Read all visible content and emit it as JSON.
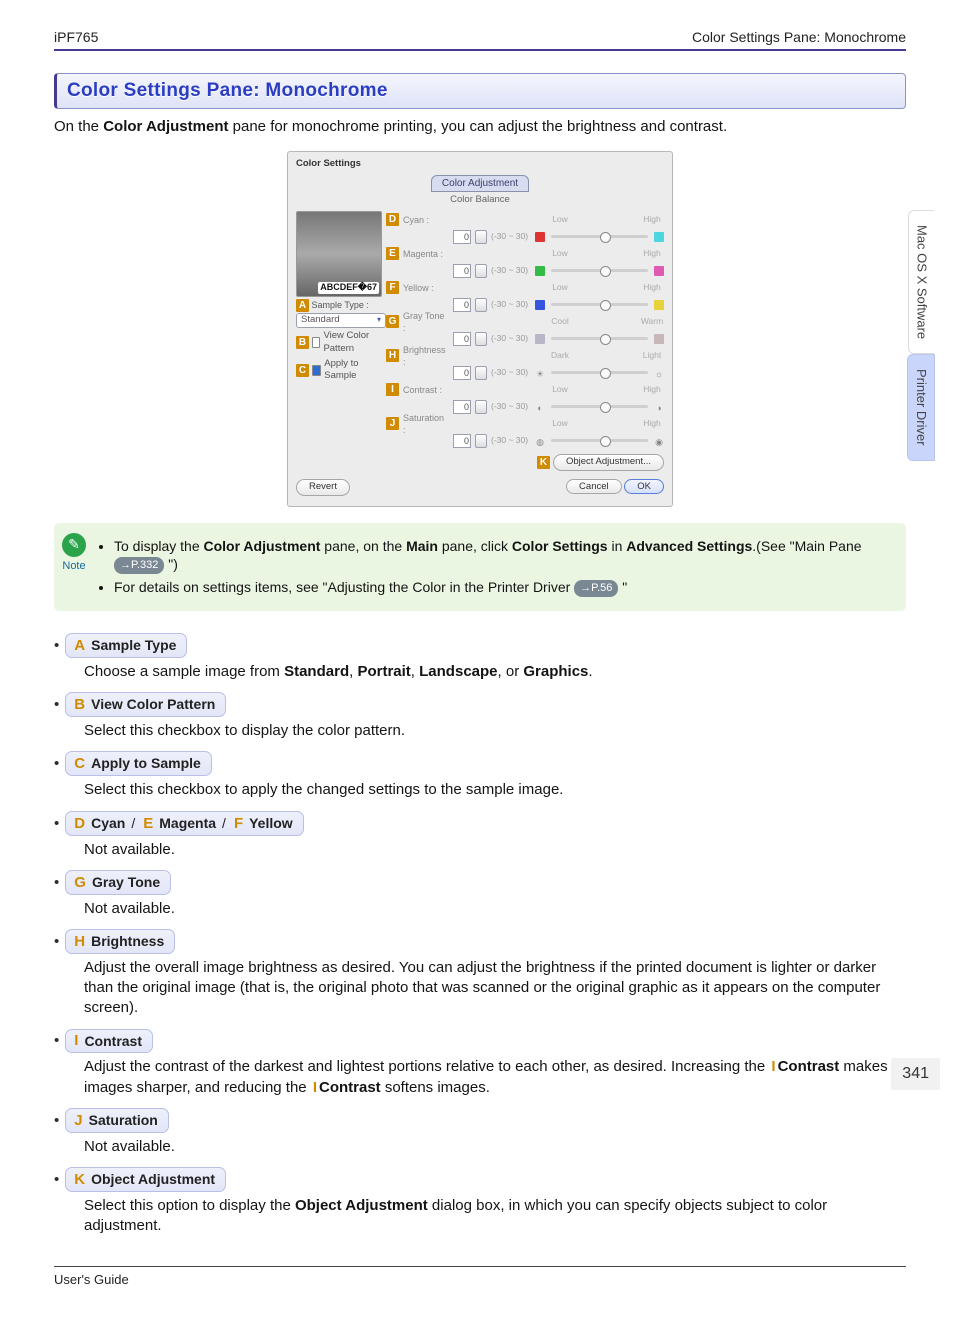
{
  "header": {
    "left": "iPF765",
    "right": "Color Settings Pane: Monochrome"
  },
  "title": "Color Settings Pane: Monochrome",
  "intro": {
    "pre": "On the ",
    "bold": "Color Adjustment",
    "post": " pane for monochrome printing, you can adjust the brightness and contrast."
  },
  "screenshot": {
    "window_title": "Color Settings",
    "tab_label": "Color Adjustment",
    "group_label": "Color Balance",
    "sample": {
      "marker": "A",
      "label": "Sample Type :",
      "dropdown_value": "Standard",
      "view_marker": "B",
      "view_label": "View Color Pattern",
      "apply_marker": "C",
      "apply_label": "Apply to Sample"
    },
    "sliders": [
      {
        "marker": "D",
        "label": "Cyan :",
        "value": "0",
        "range": "(-30 ~ 30)",
        "loLab": "Low",
        "hiLab": "High",
        "loColor": "#d33",
        "hiColor": "#4dd6e0"
      },
      {
        "marker": "E",
        "label": "Magenta :",
        "value": "0",
        "range": "(-30 ~ 30)",
        "loLab": "Low",
        "hiLab": "High",
        "loColor": "#3b4",
        "hiColor": "#e05ab4"
      },
      {
        "marker": "F",
        "label": "Yellow :",
        "value": "0",
        "range": "(-30 ~ 30)",
        "loLab": "Low",
        "hiLab": "High",
        "loColor": "#35d",
        "hiColor": "#e7d23a"
      },
      {
        "marker": "G",
        "label": "Gray Tone :",
        "value": "0",
        "range": "(-30 ~ 30)",
        "loLab": "Cool",
        "hiLab": "Warm",
        "loColor": "#b7b7c8",
        "hiColor": "#c8b7b7"
      },
      {
        "marker": "H",
        "label": "Brightness :",
        "value": "0",
        "range": "(-30 ~ 30)",
        "loLab": "Dark",
        "hiLab": "Light",
        "loGlyph": "☀",
        "hiGlyph": "☼"
      },
      {
        "marker": "I",
        "label": "Contrast :",
        "value": "0",
        "range": "(-30 ~ 30)",
        "loLab": "Low",
        "hiLab": "High",
        "loGlyph": "◐",
        "hiGlyph": "◑"
      },
      {
        "marker": "J",
        "label": "Saturation :",
        "value": "0",
        "range": "(-30 ~ 30)",
        "loLab": "Low",
        "hiLab": "High",
        "loGlyph": "◍",
        "hiGlyph": "◉"
      }
    ],
    "object_marker": "K",
    "object_btn": "Object Adjustment...",
    "revert_btn": "Revert",
    "cancel_btn": "Cancel",
    "ok_btn": "OK"
  },
  "note": {
    "caption": "Note",
    "items": [
      {
        "parts": [
          {
            "t": "text",
            "v": "To display the "
          },
          {
            "t": "b",
            "v": "Color Adjustment"
          },
          {
            "t": "text",
            "v": " pane, on the "
          },
          {
            "t": "b",
            "v": "Main"
          },
          {
            "t": "text",
            "v": " pane, click "
          },
          {
            "t": "b",
            "v": "Color Settings"
          },
          {
            "t": "text",
            "v": " in "
          },
          {
            "t": "b",
            "v": "Advanced Settings"
          },
          {
            "t": "text",
            "v": ".(See \"Main Pane "
          },
          {
            "t": "ref",
            "v": "→P.332"
          },
          {
            "t": "text",
            "v": " \")"
          }
        ]
      },
      {
        "parts": [
          {
            "t": "text",
            "v": "For details on settings items, see \"Adjusting the Color in the Printer Driver "
          },
          {
            "t": "ref",
            "v": "→P.56"
          },
          {
            "t": "text",
            "v": " \""
          }
        ]
      }
    ]
  },
  "items": [
    {
      "head": [
        {
          "mk": "A",
          "text": "Sample Type"
        }
      ],
      "desc": [
        {
          "t": "text",
          "v": "Choose a sample image from "
        },
        {
          "t": "b",
          "v": "Standard"
        },
        {
          "t": "text",
          "v": ", "
        },
        {
          "t": "b",
          "v": "Portrait"
        },
        {
          "t": "text",
          "v": ", "
        },
        {
          "t": "b",
          "v": "Landscape"
        },
        {
          "t": "text",
          "v": ", or "
        },
        {
          "t": "b",
          "v": "Graphics"
        },
        {
          "t": "text",
          "v": "."
        }
      ]
    },
    {
      "head": [
        {
          "mk": "B",
          "text": "View Color Pattern"
        }
      ],
      "desc": [
        {
          "t": "text",
          "v": "Select this checkbox to display the color pattern."
        }
      ]
    },
    {
      "head": [
        {
          "mk": "C",
          "text": "Apply to Sample"
        }
      ],
      "desc": [
        {
          "t": "text",
          "v": "Select this checkbox to apply the changed settings to the sample image."
        }
      ]
    },
    {
      "head": [
        {
          "mk": "D",
          "text": "Cyan"
        },
        {
          "mk": "E",
          "text": "Magenta"
        },
        {
          "mk": "F",
          "text": "Yellow"
        }
      ],
      "desc": [
        {
          "t": "text",
          "v": "Not available."
        }
      ]
    },
    {
      "head": [
        {
          "mk": "G",
          "text": "Gray Tone"
        }
      ],
      "desc": [
        {
          "t": "text",
          "v": "Not available."
        }
      ]
    },
    {
      "head": [
        {
          "mk": "H",
          "text": "Brightness"
        }
      ],
      "desc": [
        {
          "t": "text",
          "v": "Adjust the overall image brightness as desired. You can adjust the brightness if the printed document is lighter or darker than the original image (that is, the original photo that was scanned or the original graphic as it appears on the computer screen)."
        }
      ]
    },
    {
      "head": [
        {
          "mk": "I",
          "text": "Contrast"
        }
      ],
      "desc": [
        {
          "t": "text",
          "v": "Adjust the contrast of the darkest and lightest portions relative to each other, as desired. Increasing the "
        },
        {
          "t": "mk",
          "v": "I"
        },
        {
          "t": "b",
          "v": "Contrast"
        },
        {
          "t": "text",
          "v": " makes images sharper, and reducing the "
        },
        {
          "t": "mk",
          "v": "I"
        },
        {
          "t": "b",
          "v": "Contrast"
        },
        {
          "t": "text",
          "v": " softens images."
        }
      ]
    },
    {
      "head": [
        {
          "mk": "J",
          "text": "Saturation"
        }
      ],
      "desc": [
        {
          "t": "text",
          "v": "Not available."
        }
      ]
    },
    {
      "head": [
        {
          "mk": "K",
          "text": "Object Adjustment"
        }
      ],
      "desc": [
        {
          "t": "text",
          "v": "Select this option to display the "
        },
        {
          "t": "b",
          "v": "Object Adjustment"
        },
        {
          "t": "text",
          "v": " dialog box, in which you can specify objects subject to color adjustment."
        }
      ]
    }
  ],
  "side_tabs": {
    "top": "Mac OS X Software",
    "bottom": "Printer Driver"
  },
  "page_number": "341",
  "footer": "User's Guide"
}
